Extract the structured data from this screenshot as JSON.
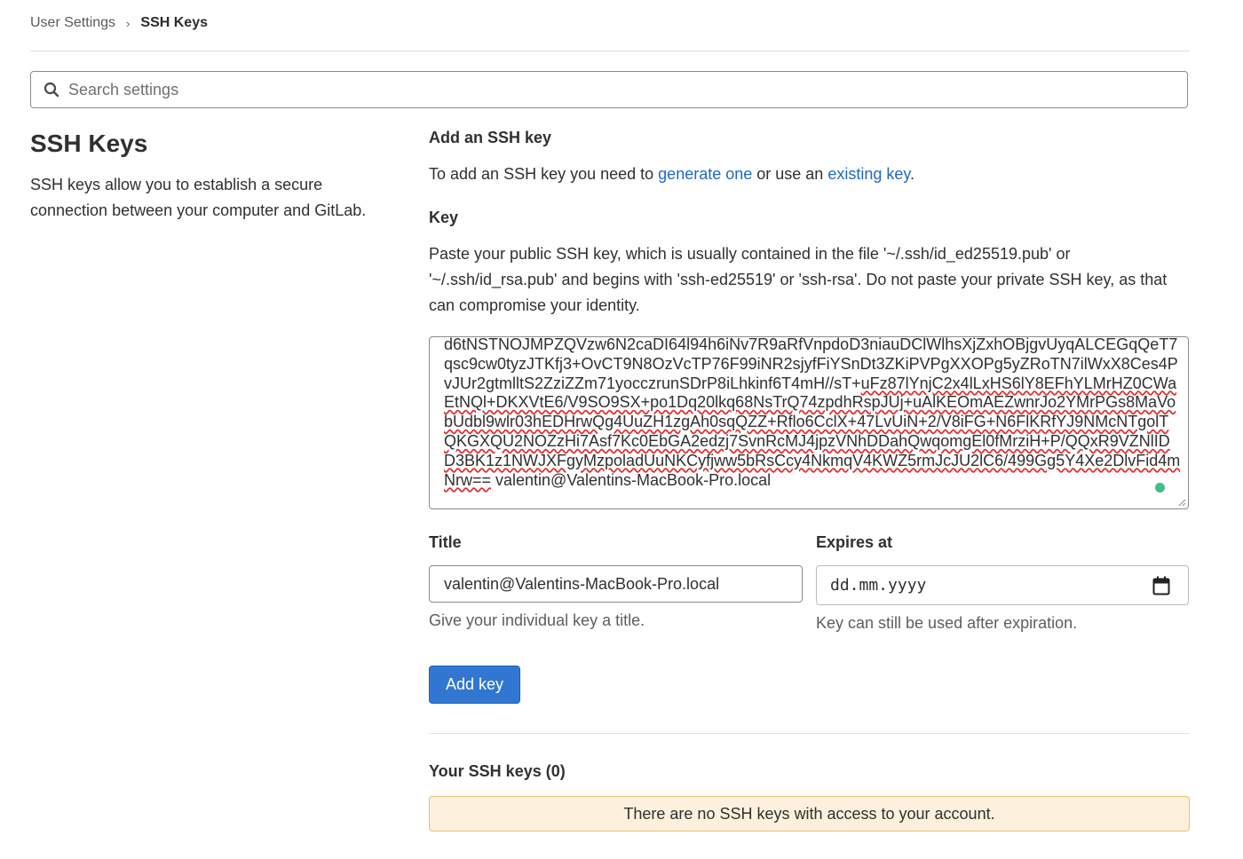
{
  "breadcrumb": {
    "parent": "User Settings",
    "separator": "›",
    "current": "SSH Keys"
  },
  "search": {
    "placeholder": "Search settings",
    "icon": "search-icon"
  },
  "sidebar": {
    "title": "SSH Keys",
    "description": "SSH keys allow you to establish a secure connection between your computer and GitLab."
  },
  "add_section": {
    "heading": "Add an SSH key",
    "text_before": "To add an SSH key you need to ",
    "generate_link": "generate one",
    "text_middle": " or use an ",
    "existing_link": "existing key",
    "text_after": "."
  },
  "key_field": {
    "label": "Key",
    "help": "Paste your public SSH key, which is usually contained in the file '~/.ssh/id_ed25519.pub' or '~/.ssh/id_rsa.pub' and begins with 'ssh-ed25519' or 'ssh-rsa'. Do not paste your private SSH key, as that can compromise your identity.",
    "value_plain": "d6tNSTNOJMPZQVzw6N2caDI64l94h6iNv7R9aRfVnpdoD3niauDClWlhsXjZxhOBjgvUyqALCEGqQeT7qsc9cw0tyzJTKfj3+OvCT9N8OzVcTP76F99iNR2sjyfFiYSnDt3ZKiPVPgXXOPg5yZRoTN7ilWxX8Ces4PvJUr2gtmlltS2ZziZZm71yocczrunSDrP8iLhkinf6T4mH//sT+",
    "value_squiggly": "uFz87lYnjC2x4lLxHS6lY8EFhYLMrHZ0CWaEtNQl+DKXVtE6/V9SO9SX+po1Dq20lkq68NsTrQ74zpdhRspJUj+uAlKEOmAEZwnrJo2YMrPGs8MaVobUdbl9wlr03hEDHrwQg4UuZH1zgAh0sqQZZ+Rflo6CclX+47LvUiN+2/V8iFG+N6FlKRfYJ9NMcNTgolTQKGXQU2NOZzHi7Asf7Kc0EbGA2edzj7SvnRcMJ4jpzVNhDDahQwqomgEl0fMrziH+P/QQxR9VZNlIDD3BK1z1NWJXFgyMzpoladUuNKCyfjww5bRsCcy4NkmqV4KWZ5rmJcJU2lC6/499Gg5Y4Xe2DlvFid4mNrw==",
    "value_tail": " valentin@Valentins-MacBook-Pro.local"
  },
  "title_field": {
    "label": "Title",
    "value": "valentin@Valentins-MacBook-Pro.local",
    "hint": "Give your individual key a title."
  },
  "expires_field": {
    "label": "Expires at",
    "value": "dd.mm.yyyy",
    "hint": "Key can still be used after expiration."
  },
  "add_button": {
    "label": "Add key",
    "color": "#3177d2"
  },
  "existing_keys": {
    "heading": "Your SSH keys (0)",
    "empty_message": "There are no SSH keys with access to your account."
  }
}
